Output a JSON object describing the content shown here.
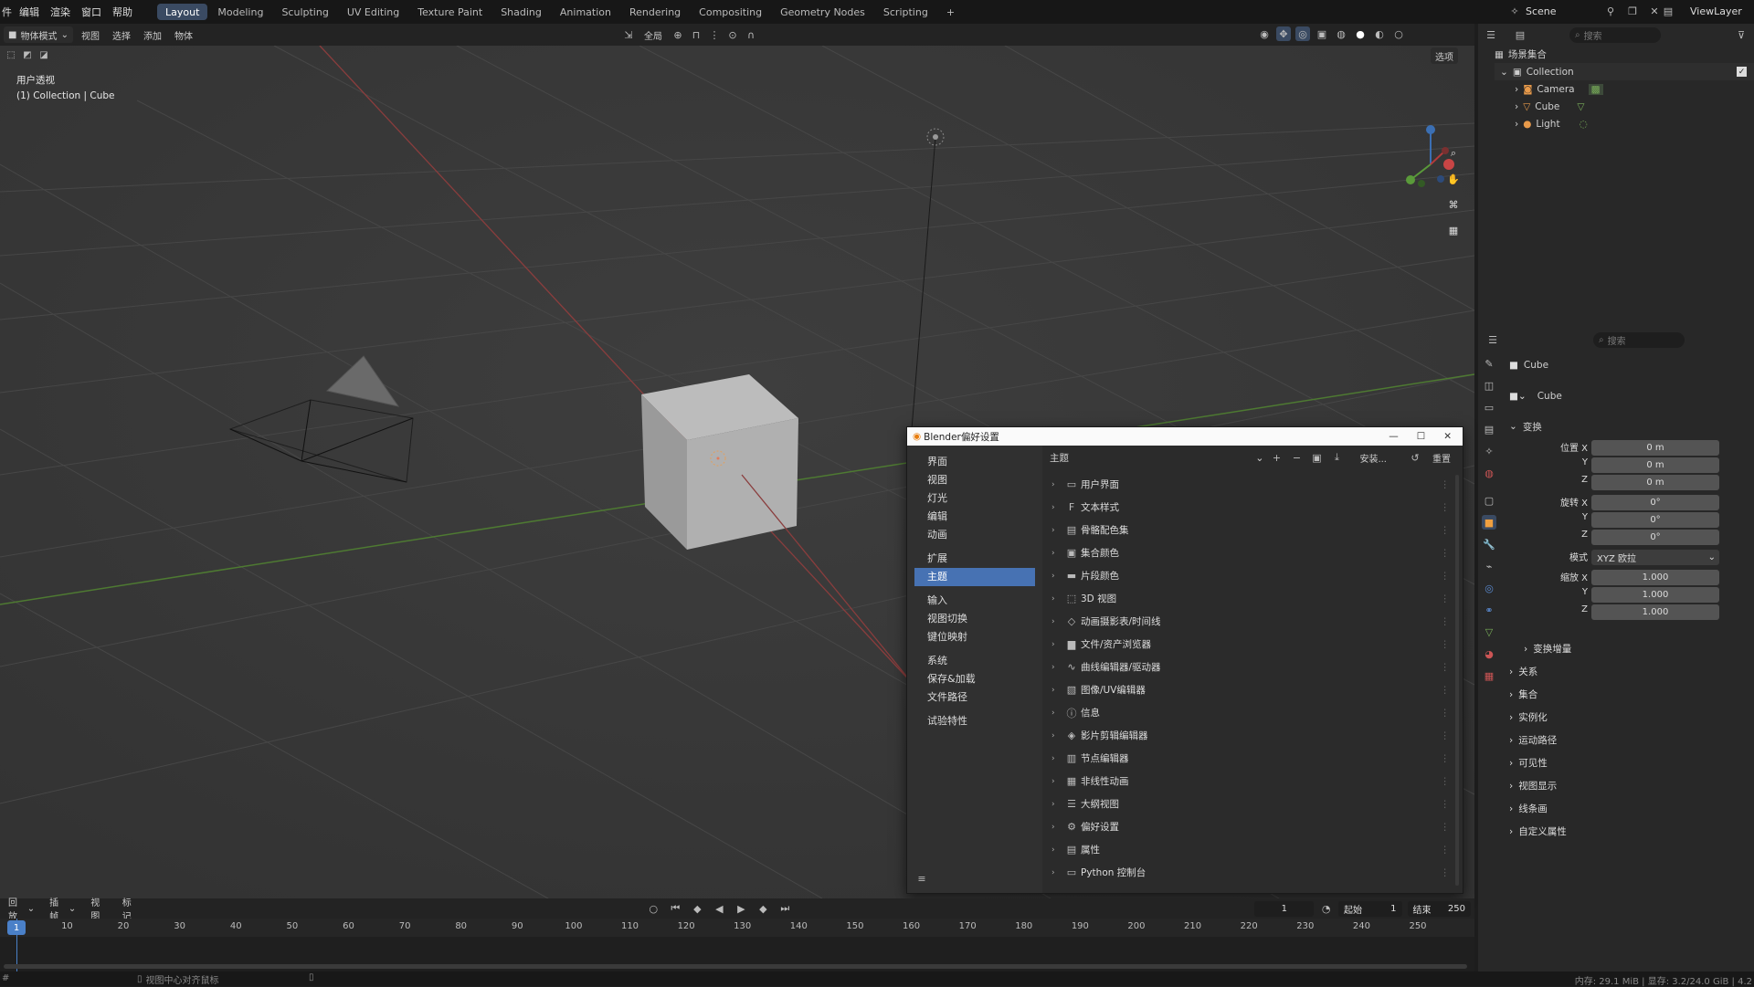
{
  "app": {
    "accent": "#4772b3",
    "active_tab_color": "#3a4a62"
  },
  "menu": {
    "file_stub": "件",
    "edit": "编辑",
    "render": "渲染",
    "window": "窗口",
    "help": "帮助"
  },
  "workspaces": [
    "Layout",
    "Modeling",
    "Sculpting",
    "UV Editing",
    "Texture Paint",
    "Shading",
    "Animation",
    "Rendering",
    "Compositing",
    "Geometry Nodes",
    "Scripting"
  ],
  "workspace_add": "+",
  "scene": {
    "name": "Scene",
    "viewlayer": "ViewLayer"
  },
  "viewport_header": {
    "mode": "物体模式",
    "view": "视图",
    "select": "选择",
    "add": "添加",
    "object": "物体",
    "transform_space": "全局",
    "options": "选项"
  },
  "viewport": {
    "view_name": "用户透视",
    "context": "(1) Collection | Cube"
  },
  "outliner": {
    "search_placeholder": "搜索",
    "root": "场景集合",
    "collection": "Collection",
    "items": [
      {
        "name": "Camera"
      },
      {
        "name": "Cube"
      },
      {
        "name": "Light"
      }
    ]
  },
  "properties": {
    "search_placeholder": "搜索",
    "object_name": "Cube",
    "datablock_name": "Cube",
    "transform_header": "变换",
    "location": {
      "label_x": "位置 X",
      "x": "0 m",
      "y": "0 m",
      "z": "0 m"
    },
    "rotation": {
      "label_x": "旋转 X",
      "x": "0°",
      "y": "0°",
      "z": "0°"
    },
    "mode": {
      "label": "模式",
      "value": "XYZ 欧拉"
    },
    "scale": {
      "label_x": "缩放 X",
      "x": "1.000",
      "y": "1.000",
      "z": "1.000"
    },
    "axis_y": "Y",
    "axis_z": "Z",
    "delta": "变换增量",
    "sections": [
      "关系",
      "集合",
      "实例化",
      "运动路径",
      "可见性",
      "视图显示",
      "线条画",
      "自定义属性"
    ]
  },
  "prefs": {
    "title": "Blender偏好设置",
    "nav_groups": [
      [
        "界面",
        "视图",
        "灯光",
        "编辑",
        "动画"
      ],
      [
        "扩展",
        "主题"
      ],
      [
        "输入",
        "视图切换",
        "键位映射"
      ],
      [
        "系统",
        "保存&加载",
        "文件路径"
      ],
      [
        "试验特性"
      ]
    ],
    "active_nav": "主题",
    "theme_label": "主题",
    "install": "安装...",
    "reset": "重置",
    "theme_items": [
      {
        "label": "用户界面",
        "icon": "user-interface-icon"
      },
      {
        "label": "文本样式",
        "icon": "font-icon"
      },
      {
        "label": "骨骼配色集",
        "icon": "bone-icon"
      },
      {
        "label": "集合颜色",
        "icon": "collection-color-icon"
      },
      {
        "label": "片段颜色",
        "icon": "strip-color-icon"
      },
      {
        "label": "3D 视图",
        "icon": "view3d-icon"
      },
      {
        "label": "动画摄影表/时间线",
        "icon": "dopesheet-icon"
      },
      {
        "label": "文件/资产浏览器",
        "icon": "folder-icon"
      },
      {
        "label": "曲线编辑器/驱动器",
        "icon": "graph-icon"
      },
      {
        "label": "图像/UV编辑器",
        "icon": "image-icon"
      },
      {
        "label": "信息",
        "icon": "info-icon"
      },
      {
        "label": "影片剪辑编辑器",
        "icon": "clip-icon"
      },
      {
        "label": "节点编辑器",
        "icon": "node-icon"
      },
      {
        "label": "非线性动画",
        "icon": "nla-icon"
      },
      {
        "label": "大纲视图",
        "icon": "outliner-icon"
      },
      {
        "label": "偏好设置",
        "icon": "gear-icon"
      },
      {
        "label": "属性",
        "icon": "properties-icon"
      },
      {
        "label": "Python 控制台",
        "icon": "console-icon"
      }
    ]
  },
  "timeline": {
    "playback": "回放",
    "keying": "插帧",
    "view": "视图",
    "marker": "标记",
    "current_frame": "1",
    "start_label": "起始",
    "start": "1",
    "end_label": "结束",
    "end": "250",
    "ticks": [
      "1",
      "10",
      "20",
      "30",
      "40",
      "50",
      "60",
      "70",
      "80",
      "90",
      "100",
      "110",
      "120",
      "130",
      "140",
      "150",
      "160",
      "170",
      "180",
      "190",
      "200",
      "210",
      "220",
      "230",
      "240",
      "250"
    ]
  },
  "status": {
    "left_stub": "#",
    "hint": "视图中心对齐鼠标",
    "memory": "内存: 29.1 MiB | 显存: 3.2/24.0 GiB | 4.2"
  }
}
